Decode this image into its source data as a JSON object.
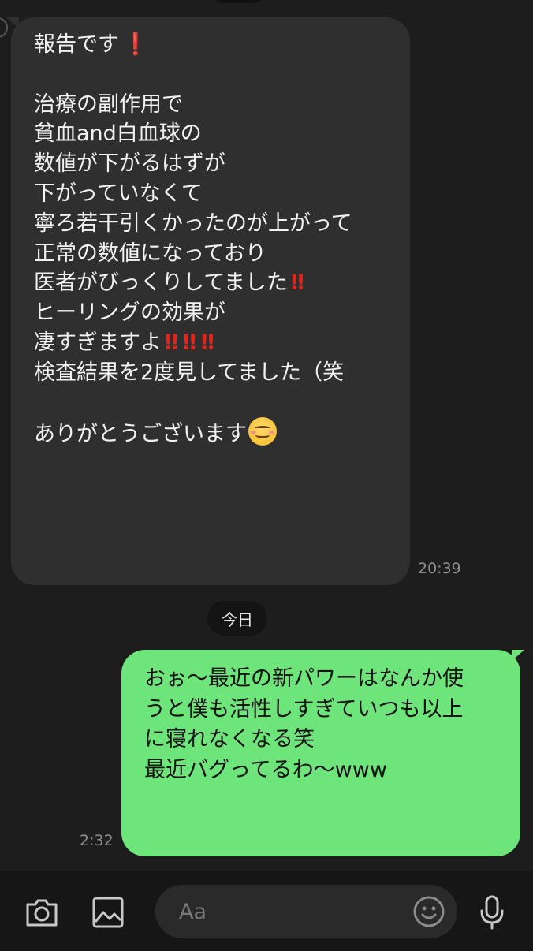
{
  "messages": {
    "incoming": {
      "lines": [
        "報告です",
        "",
        "治療の副作用で",
        "貧血and白血球の",
        "数値が下がるはずが",
        "下がっていなくて",
        "寧ろ若干引くかったのが上がって",
        "正常の数値になっており",
        "医者がびっくりしてました",
        "ヒーリングの効果が",
        "凄すぎますよ",
        "検査結果を2度見してました（笑",
        "",
        "ありがとうございます"
      ],
      "emoji_bang": "‼",
      "emoji_bang_single": "❗",
      "time": "20:39"
    },
    "date_separator": "今日",
    "outgoing": {
      "lines": [
        "おぉ〜最近の新パワーはなんか使",
        "うと僕も活性しすぎていつも以上",
        "に寝れなくなる笑",
        "最近バグってるわ〜www"
      ],
      "time": "2:32"
    }
  },
  "input_bar": {
    "placeholder": "Aa",
    "icons": [
      "camera-icon",
      "image-icon",
      "emoji-icon",
      "microphone-icon"
    ]
  },
  "colors": {
    "background": "#1d1d1d",
    "incoming_bubble": "#2f2f2f",
    "outgoing_bubble": "#6de57a",
    "alert_red": "#e0261c"
  }
}
